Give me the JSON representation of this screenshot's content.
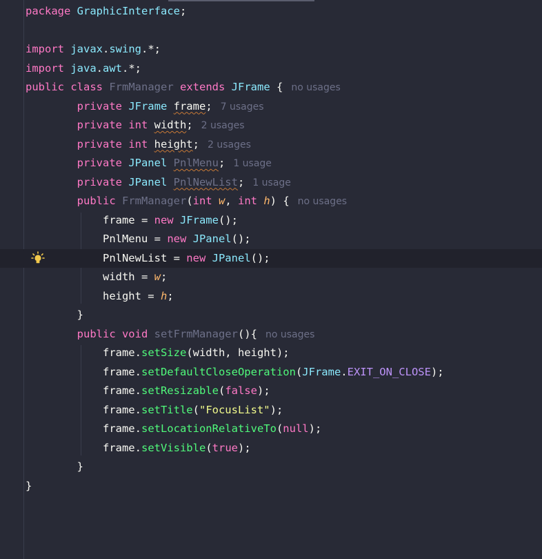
{
  "editor": {
    "lines": [
      {
        "segments": [
          {
            "t": "package ",
            "c": "kw"
          },
          {
            "t": "GraphicInterface",
            "c": "ty"
          },
          {
            "t": ";",
            "c": "plain"
          }
        ]
      },
      {
        "segments": []
      },
      {
        "segments": [
          {
            "t": "import ",
            "c": "kw"
          },
          {
            "t": "javax",
            "c": "ty"
          },
          {
            "t": ".",
            "c": "plain"
          },
          {
            "t": "swing",
            "c": "ty"
          },
          {
            "t": ".*;",
            "c": "plain"
          }
        ]
      },
      {
        "segments": [
          {
            "t": "import ",
            "c": "kw"
          },
          {
            "t": "java",
            "c": "ty"
          },
          {
            "t": ".",
            "c": "plain"
          },
          {
            "t": "awt",
            "c": "ty"
          },
          {
            "t": ".*;",
            "c": "plain"
          }
        ]
      },
      {
        "segments": [
          {
            "t": "public class ",
            "c": "kw"
          },
          {
            "t": "FrmManager",
            "c": "dim"
          },
          {
            "t": " extends ",
            "c": "kw"
          },
          {
            "t": "JFrame",
            "c": "ty"
          },
          {
            "t": " {",
            "c": "plain"
          }
        ],
        "hint": "no usages"
      },
      {
        "segments": [
          {
            "t": "        private ",
            "c": "kw"
          },
          {
            "t": "JFrame ",
            "c": "ty"
          },
          {
            "t": "frame",
            "c": "plain warn"
          },
          {
            "t": ";",
            "c": "plain"
          }
        ],
        "hint": "7 usages"
      },
      {
        "segments": [
          {
            "t": "        private ",
            "c": "kw"
          },
          {
            "t": "int ",
            "c": "kw"
          },
          {
            "t": "width",
            "c": "plain warn"
          },
          {
            "t": ";",
            "c": "plain"
          }
        ],
        "hint": "2 usages"
      },
      {
        "segments": [
          {
            "t": "        private ",
            "c": "kw"
          },
          {
            "t": "int ",
            "c": "kw"
          },
          {
            "t": "height",
            "c": "plain warn"
          },
          {
            "t": ";",
            "c": "plain"
          }
        ],
        "hint": "2 usages"
      },
      {
        "segments": [
          {
            "t": "        private ",
            "c": "kw"
          },
          {
            "t": "JPanel ",
            "c": "ty"
          },
          {
            "t": "PnlMenu",
            "c": "dim warn"
          },
          {
            "t": ";",
            "c": "plain"
          }
        ],
        "hint": "1 usage"
      },
      {
        "segments": [
          {
            "t": "        private ",
            "c": "kw"
          },
          {
            "t": "JPanel ",
            "c": "ty"
          },
          {
            "t": "PnlNewList",
            "c": "dim warn"
          },
          {
            "t": ";",
            "c": "plain"
          }
        ],
        "hint": "1 usage"
      },
      {
        "segments": [
          {
            "t": "        public ",
            "c": "kw"
          },
          {
            "t": "FrmManager",
            "c": "dim"
          },
          {
            "t": "(",
            "c": "plain"
          },
          {
            "t": "int ",
            "c": "kw"
          },
          {
            "t": "w",
            "c": "param"
          },
          {
            "t": ", ",
            "c": "plain"
          },
          {
            "t": "int ",
            "c": "kw"
          },
          {
            "t": "h",
            "c": "param"
          },
          {
            "t": ") {",
            "c": "plain"
          }
        ],
        "hint": "no usages"
      },
      {
        "segments": [
          {
            "t": "            frame = ",
            "c": "plain"
          },
          {
            "t": "new ",
            "c": "kw"
          },
          {
            "t": "JFrame",
            "c": "ty"
          },
          {
            "t": "();",
            "c": "plain"
          }
        ]
      },
      {
        "segments": [
          {
            "t": "            PnlMenu = ",
            "c": "plain"
          },
          {
            "t": "new ",
            "c": "kw"
          },
          {
            "t": "JPanel",
            "c": "ty"
          },
          {
            "t": "();",
            "c": "plain"
          }
        ]
      },
      {
        "segments": [
          {
            "t": "            PnlNewList = ",
            "c": "plain"
          },
          {
            "t": "new ",
            "c": "kw"
          },
          {
            "t": "JPanel",
            "c": "ty"
          },
          {
            "t": "();",
            "c": "plain"
          }
        ],
        "current": true
      },
      {
        "segments": [
          {
            "t": "            width = ",
            "c": "plain"
          },
          {
            "t": "w",
            "c": "param"
          },
          {
            "t": ";",
            "c": "plain"
          }
        ]
      },
      {
        "segments": [
          {
            "t": "            height = ",
            "c": "plain"
          },
          {
            "t": "h",
            "c": "param"
          },
          {
            "t": ";",
            "c": "plain"
          }
        ]
      },
      {
        "segments": [
          {
            "t": "        }",
            "c": "plain"
          }
        ]
      },
      {
        "segments": [
          {
            "t": "        public void ",
            "c": "kw"
          },
          {
            "t": "setFrmManager",
            "c": "dim"
          },
          {
            "t": "(){",
            "c": "plain"
          }
        ],
        "hint": "no usages"
      },
      {
        "segments": [
          {
            "t": "            frame.",
            "c": "plain"
          },
          {
            "t": "setSize",
            "c": "fn"
          },
          {
            "t": "(width, height);",
            "c": "plain"
          }
        ]
      },
      {
        "segments": [
          {
            "t": "            frame.",
            "c": "plain"
          },
          {
            "t": "setDefaultCloseOperation",
            "c": "fn"
          },
          {
            "t": "(",
            "c": "plain"
          },
          {
            "t": "JFrame",
            "c": "ty"
          },
          {
            "t": ".",
            "c": "plain"
          },
          {
            "t": "EXIT_ON_CLOSE",
            "c": "const"
          },
          {
            "t": ");",
            "c": "plain"
          }
        ]
      },
      {
        "segments": [
          {
            "t": "            frame.",
            "c": "plain"
          },
          {
            "t": "setResizable",
            "c": "fn"
          },
          {
            "t": "(",
            "c": "plain"
          },
          {
            "t": "false",
            "c": "kw"
          },
          {
            "t": ");",
            "c": "plain"
          }
        ]
      },
      {
        "segments": [
          {
            "t": "            frame.",
            "c": "plain"
          },
          {
            "t": "setTitle",
            "c": "fn"
          },
          {
            "t": "(",
            "c": "plain"
          },
          {
            "t": "\"FocusList\"",
            "c": "str"
          },
          {
            "t": ");",
            "c": "plain"
          }
        ]
      },
      {
        "segments": [
          {
            "t": "            frame.",
            "c": "plain"
          },
          {
            "t": "setLocationRelativeTo",
            "c": "fn"
          },
          {
            "t": "(",
            "c": "plain"
          },
          {
            "t": "null",
            "c": "kw"
          },
          {
            "t": ");",
            "c": "plain"
          }
        ]
      },
      {
        "segments": [
          {
            "t": "            frame.",
            "c": "plain"
          },
          {
            "t": "setVisible",
            "c": "fn"
          },
          {
            "t": "(",
            "c": "plain"
          },
          {
            "t": "true",
            "c": "kw"
          },
          {
            "t": ");",
            "c": "plain"
          }
        ]
      },
      {
        "segments": [
          {
            "t": "        }",
            "c": "plain"
          }
        ]
      },
      {
        "segments": [
          {
            "t": "}",
            "c": "plain"
          }
        ]
      }
    ]
  },
  "icons": {
    "intention_bulb": "lightbulb-icon"
  },
  "colors": {
    "background": "#282a36",
    "current_line": "#21222c",
    "keyword": "#ff79c6",
    "type": "#8be9fd",
    "method": "#50fa7b",
    "string": "#f1fa8c",
    "parameter": "#ffb86c",
    "constant": "#bd93f9",
    "hint": "#6d7088"
  }
}
